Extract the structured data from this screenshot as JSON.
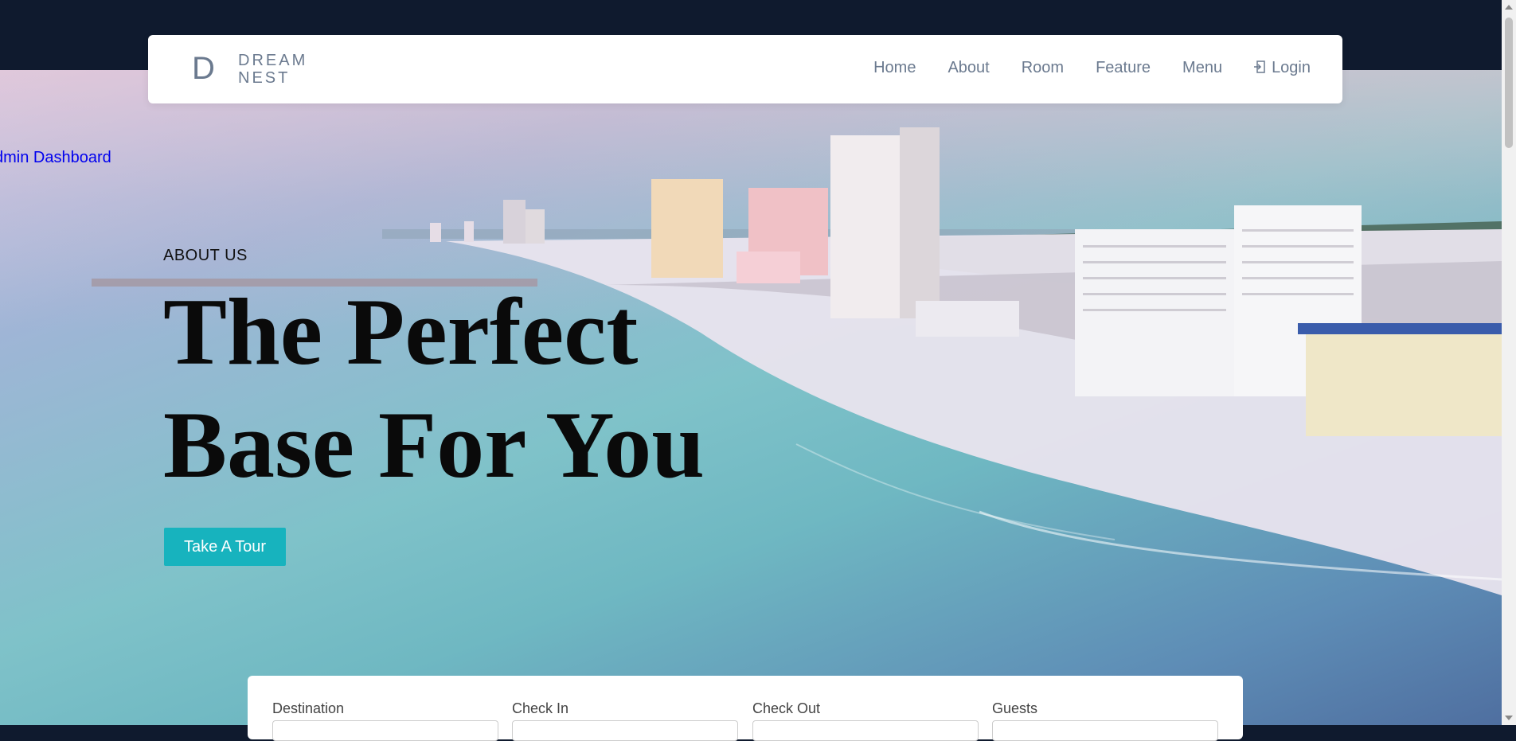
{
  "brand": {
    "letter": "D",
    "line1": "DREAM",
    "line2": "NEST"
  },
  "nav": {
    "items": [
      "Home",
      "About",
      "Room",
      "Feature",
      "Menu"
    ],
    "login": "Login"
  },
  "admin_link": "dmin Dashboard",
  "hero": {
    "label": "ABOUT US",
    "headline_line1": "The Perfect",
    "headline_line2": "Base For You",
    "cta": "Take A Tour"
  },
  "booking": {
    "fields": [
      "Destination",
      "Check In",
      "Check Out",
      "Guests"
    ]
  },
  "colors": {
    "accent": "#17b3be",
    "dark": "#0f1a2e",
    "nav_text": "#6b7a8f",
    "link": "#0000ee"
  }
}
